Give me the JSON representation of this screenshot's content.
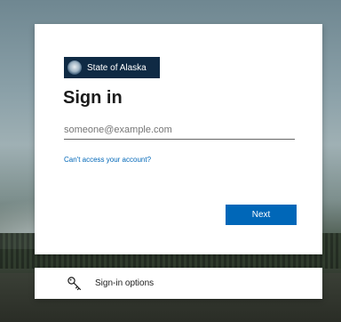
{
  "brand": {
    "logo_text": "State of Alaska",
    "seal_icon": "state-seal-icon"
  },
  "signin": {
    "title": "Sign in",
    "email_placeholder": "someone@example.com",
    "email_value": "",
    "cant_access_link": "Can't access your account?",
    "next_button": "Next"
  },
  "options": {
    "label": "Sign-in options",
    "icon": "key-icon"
  },
  "colors": {
    "accent": "#0067b8",
    "logo_background": "#0f2a44"
  }
}
